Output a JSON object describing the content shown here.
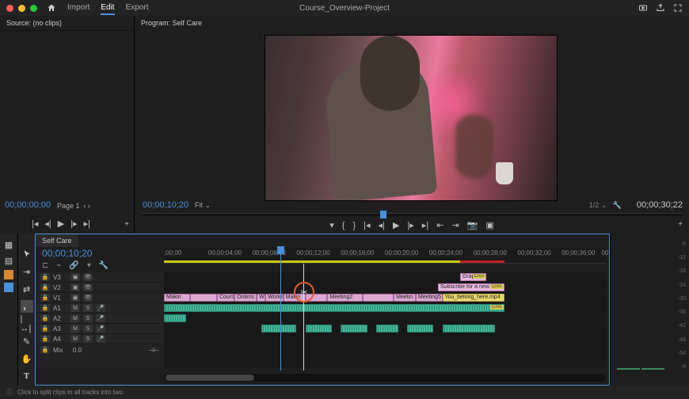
{
  "titlebar": {
    "project_title": "Course_Overview-Project",
    "tabs": {
      "import": "Import",
      "edit": "Edit",
      "export": "Export"
    }
  },
  "source": {
    "tab_label": "Source: (no clips)",
    "timecode": "00;00;00;00",
    "page_label": "Page 1"
  },
  "program": {
    "tab_label": "Program: Self Care",
    "timecode_left": "00;00;10;20",
    "fit_label": "Fit",
    "fraction": "1/2",
    "timecode_right": "00;00;30;22"
  },
  "timeline": {
    "sequence_tab": "Self Care",
    "timecode": "00;00;10;20",
    "ruler_ticks": [
      ";00;00",
      "00;00;04;00",
      "00;00;08;00",
      "00;00;12;00",
      "00;00;16;00",
      "00;00;20;00",
      "00;00;24;00",
      "00;00;28;00",
      "00;00;32;00",
      "00;00;36;00",
      "00;00;"
    ],
    "mix_label": "Mix",
    "mix_value": "0.0",
    "tracks": {
      "v3": "V3",
      "v2": "V2",
      "v1": "V1",
      "a1": "A1",
      "a2": "A2",
      "a3": "A3",
      "a4": "A4"
    },
    "track_buttons": {
      "m": "M",
      "s": "S"
    },
    "clips": {
      "graphic": "Graphic",
      "subscribe": "Subscribe for a new Se",
      "you_belong": "You_belong_here.mp4",
      "cross": "Cros",
      "v1": [
        "Makin",
        "",
        "Cours",
        "Onlims",
        "W",
        "Works",
        "Makin",
        "",
        "Meeting2",
        "",
        "Meetin",
        "Meeting5"
      ]
    }
  },
  "meters": {
    "scale": [
      "-6",
      "-12",
      "-18",
      "-24",
      "-30",
      "-36",
      "-42",
      "-48",
      "-54",
      "-8"
    ]
  },
  "statusbar": {
    "hint": "Click to split clips in all tracks into two."
  }
}
